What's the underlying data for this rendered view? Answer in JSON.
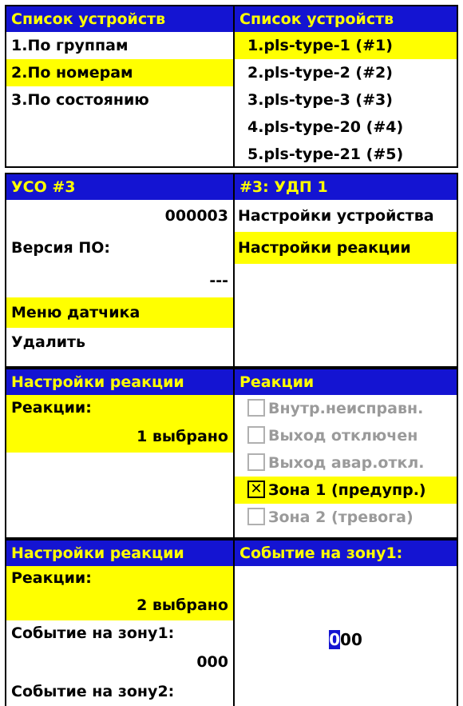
{
  "p1": {
    "title": "Список устройств",
    "items": [
      "1.По группам",
      "2.По номерам",
      "3.По состоянию"
    ]
  },
  "p2": {
    "title": "Список устройств",
    "items": [
      "1.pls-type-1  (#1)",
      "2.pls-type-2  (#2)",
      "3.pls-type-3  (#3)",
      "4.pls-type-20  (#4)",
      "5.pls-type-21  (#5)"
    ]
  },
  "p3": {
    "title": "УСО  #3",
    "serial": "000003",
    "version_label": "Версия ПО:",
    "version_value": "---",
    "sensor_menu": "Меню датчика",
    "delete": "Удалить"
  },
  "p4": {
    "title": "#3: УДП 1",
    "device_settings": "Настройки устройства",
    "reaction_settings": "Настройки реакции"
  },
  "p5": {
    "title": "Настройки реакции",
    "reactions_label": "Реакции:",
    "reactions_value": "1 выбрано"
  },
  "p6": {
    "title": "Реакции",
    "items": [
      {
        "label": "Внутр.неисправн.",
        "check": ""
      },
      {
        "label": "Выход  отключен",
        "check": ""
      },
      {
        "label": "Выход  авар.откл.",
        "check": ""
      },
      {
        "label": "Зона  1  (предупр.)",
        "check": "✕"
      },
      {
        "label": "Зона  2  (тревога)",
        "check": ""
      }
    ]
  },
  "p7": {
    "title": "Настройки реакции",
    "reactions_label": "Реакции:",
    "reactions_value": "2 выбрано",
    "event1_label": "Событие  на  зону1:",
    "event1_value": "000",
    "event2_label": "Событие  на  зону2:"
  },
  "p8": {
    "title": "Событие  на  зону1:",
    "cursor_digit": "0",
    "rest_digits": "00"
  },
  "colors": {
    "header_bg": "#1414d2",
    "header_text": "#ffff00",
    "selection": "#ffff00"
  }
}
